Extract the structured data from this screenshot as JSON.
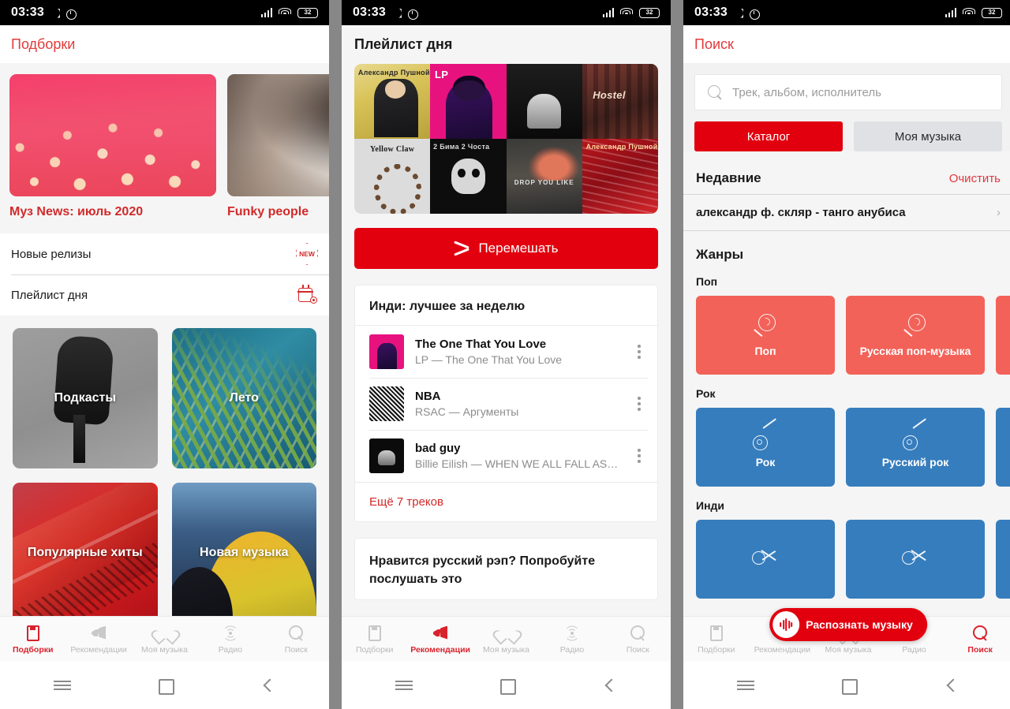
{
  "status_bar": {
    "time": "03:33",
    "battery": "32",
    "icons": [
      "moon-icon",
      "alarm-icon",
      "signal-icon",
      "wifi-icon",
      "battery-icon"
    ]
  },
  "bottom_nav": {
    "items": [
      {
        "label": "Подборки",
        "icon": "book-icon"
      },
      {
        "label": "Рекомендации",
        "icon": "megaphone-icon"
      },
      {
        "label": "Моя музыка",
        "icon": "heart-icon"
      },
      {
        "label": "Радио",
        "icon": "radio-waves-icon"
      },
      {
        "label": "Поиск",
        "icon": "search-icon"
      }
    ]
  },
  "android_nav": {
    "menu": "menu-icon",
    "home": "home-square-icon",
    "back": "back-chevron-icon"
  },
  "colors": {
    "accent_red": "#e2000f",
    "title_red": "#e23a3a",
    "link_red": "#d12a2a",
    "pop_card": "#f26259",
    "rock_card": "#367dbd",
    "bg_gray": "#f5f5f5"
  },
  "panel1": {
    "title": "Подборки",
    "active_nav": "Подборки",
    "hero_cards": [
      {
        "title": "Муз News: июль 2020",
        "art": "pink-flowers-photo"
      },
      {
        "title": "Funky people",
        "art": "blurred-indoor-photo"
      }
    ],
    "list_rows": [
      {
        "label": "Новые релизы",
        "icon": "new-badge-icon",
        "badge_text": "NEW"
      },
      {
        "label": "Плейлист дня",
        "icon": "calendar-music-icon"
      }
    ],
    "tiles": [
      {
        "label": "Подкасты",
        "art": "microphone-photo"
      },
      {
        "label": "Лето",
        "art": "palm-leaf-photo"
      },
      {
        "label": "Популярные хиты",
        "art": "red-escalator-photo"
      },
      {
        "label": "Новая музыка",
        "art": "yellow-dunes-photo"
      }
    ]
  },
  "panel2": {
    "active_nav": "Рекомендации",
    "playlist_title": "Плейлист дня",
    "collage_covers": [
      "Александр Пушной",
      "LP",
      "Billie Eilish",
      "Hostel",
      "Yellow Claw",
      "2 Бима 2 Чоста",
      "DROP YOU LIKE",
      "Александр Пушной"
    ],
    "shuffle_button": "Перемешать",
    "shuffle_icon": "shuffle-icon",
    "indie_card": {
      "title": "Инди: лучшее за неделю",
      "tracks": [
        {
          "name": "The One That You Love",
          "subtitle": "LP — The One That You Love",
          "cover": "lp-cover"
        },
        {
          "name": "NBA",
          "subtitle": "RSAC — Аргументы",
          "cover": "rsac-cover"
        },
        {
          "name": "bad guy",
          "subtitle": "Billie Eilish — WHEN WE ALL FALL AS…",
          "cover": "billie-cover"
        }
      ],
      "more_link": "Ещё 7 треков"
    },
    "rap_card_title": "Нравится русский рэп? Попробуйте послушать это"
  },
  "panel3": {
    "title": "Поиск",
    "active_nav": "Поиск",
    "search": {
      "placeholder": "Трек, альбом, исполнитель",
      "icon": "search-icon"
    },
    "segments": [
      {
        "label": "Каталог",
        "selected": true
      },
      {
        "label": "Моя музыка",
        "selected": false
      }
    ],
    "recent": {
      "title": "Недавние",
      "clear_label": "Очистить",
      "items": [
        {
          "text": "александр ф. скляр - танго анубиса",
          "chevron": "chevron-right-icon"
        }
      ]
    },
    "genres": {
      "title": "Жанры",
      "groups": [
        {
          "name": "Поп",
          "color": "#f26259",
          "icon": "lollipop-icon",
          "cards": [
            "Поп",
            "Русская поп-музыка",
            ""
          ]
        },
        {
          "name": "Рок",
          "color": "#367dbd",
          "icon": "guitar-icon",
          "cards": [
            "Рок",
            "Русский рок",
            ""
          ]
        },
        {
          "name": "Инди",
          "color": "#367dbd",
          "icon": "microphone-icon",
          "cards": [
            "",
            "",
            ""
          ]
        }
      ]
    },
    "fab": {
      "label": "Распознать музыку",
      "icon": "waveform-icon"
    }
  }
}
